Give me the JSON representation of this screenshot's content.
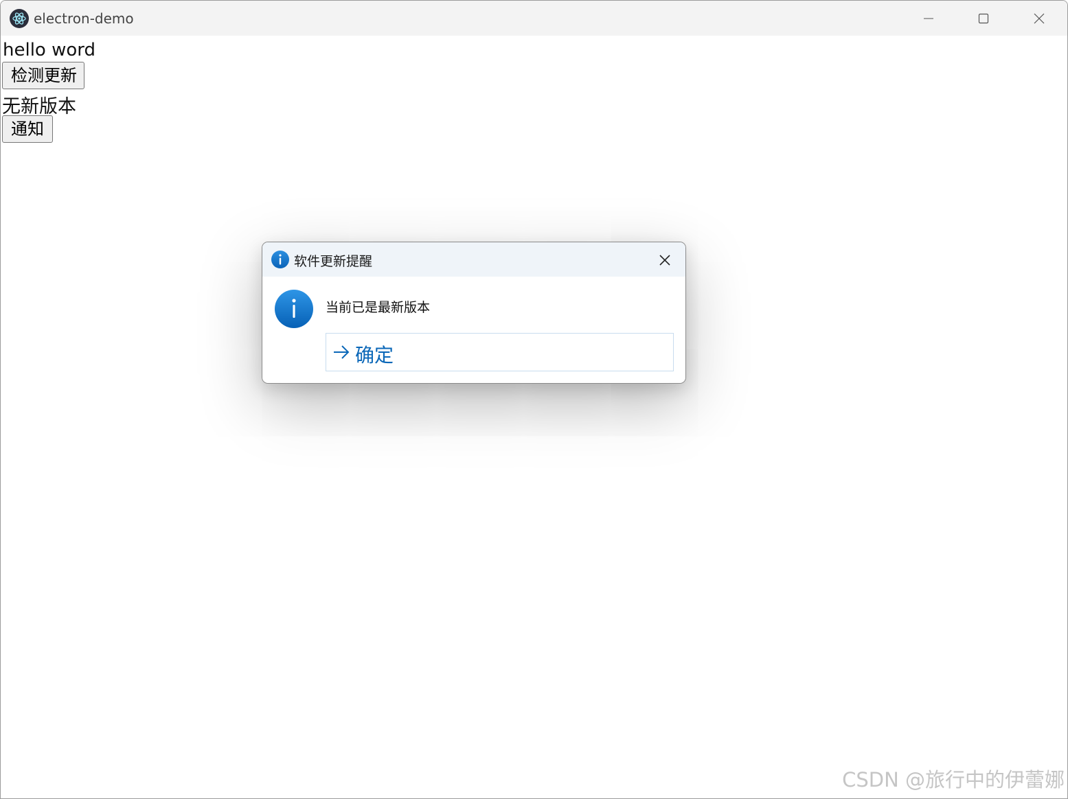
{
  "window": {
    "title": "electron-demo",
    "app_icon": "electron-atom-icon"
  },
  "content": {
    "heading": "hello word",
    "check_update_button": "检测更新",
    "status_text": "无新版本",
    "notify_button": "通知"
  },
  "dialog": {
    "title": "软件更新提醒",
    "title_icon": "info-icon",
    "message": "当前已是最新版本",
    "confirm_label": "确定",
    "confirm_icon": "arrow-right-icon",
    "accent_color": "#0a67b8"
  },
  "watermark": "CSDN @旅行中的伊蕾娜"
}
